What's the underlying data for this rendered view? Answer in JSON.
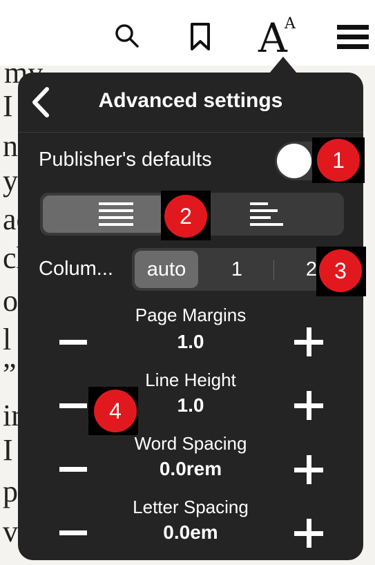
{
  "toolbar": {
    "icons": [
      "search-icon",
      "bookmark-icon",
      "font-size-icon",
      "menu-icon"
    ],
    "font_icon_large": "A",
    "font_icon_small": "A"
  },
  "background_text": [
    "my  ",
    "I",
    "n",
    "y",
    "ac",
    "ch",
    "o",
    "l",
    "”",
    "ir",
    "I",
    "p",
    "v"
  ],
  "panel": {
    "title": "Advanced settings",
    "publisher_defaults_label": "Publisher's defaults",
    "publisher_defaults_on": false,
    "columns_label": "Colum...",
    "columns_options": [
      "auto",
      "1",
      "2"
    ],
    "columns_selected": "auto",
    "alignment_selected": "justify",
    "spinners": [
      {
        "label": "Page Margins",
        "value": "1.0"
      },
      {
        "label": "Line Height",
        "value": "1.0"
      },
      {
        "label": "Word Spacing",
        "value": "0.0rem"
      },
      {
        "label": "Letter Spacing",
        "value": "0.0em"
      }
    ]
  },
  "annotations": [
    "1",
    "2",
    "3",
    "4"
  ],
  "colors": {
    "panel_bg": "#242424",
    "segment_bg": "#3a3a3a",
    "segment_selected": "#6b6b6b",
    "badge_red": "#e1191e"
  }
}
